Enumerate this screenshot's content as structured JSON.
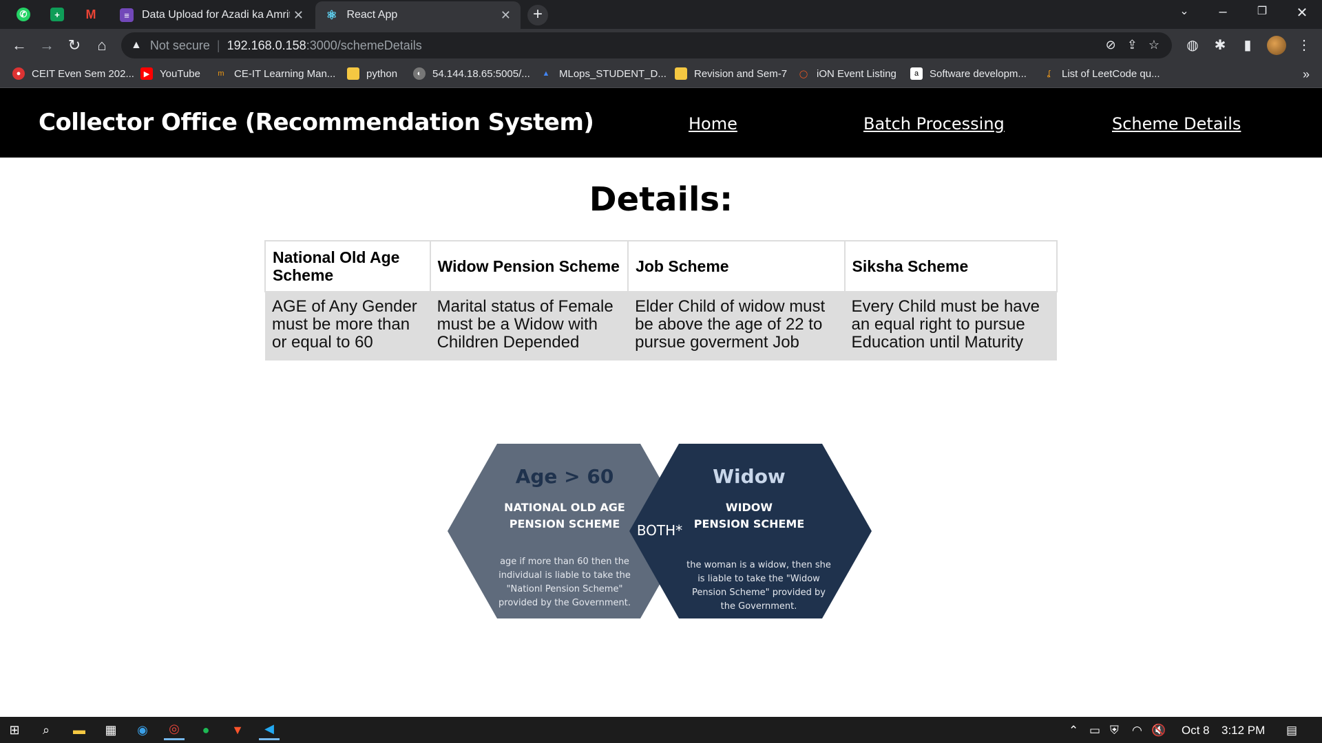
{
  "browser": {
    "tabs": [
      {
        "title": "Data Upload for Azadi ka Amrit M",
        "active": false
      },
      {
        "title": "React App",
        "active": true
      }
    ],
    "pinned_icons": [
      "whatsapp-icon",
      "sheets-icon",
      "gmail-icon"
    ],
    "address": {
      "security": "Not secure",
      "host": "192.168.0.158",
      "path": ":3000/schemeDetails"
    },
    "bookmarks": [
      "CEIT Even Sem 202...",
      "YouTube",
      "CE-IT Learning Man...",
      "python",
      "54.144.18.65:5005/...",
      "MLops_STUDENT_D...",
      "Revision and Sem-7",
      "iON Event Listing",
      "Software developm...",
      "List of LeetCode qu..."
    ]
  },
  "app": {
    "brand": "Collector Office (Recommendation System)",
    "nav": {
      "home": "Home",
      "batch": "Batch Processing",
      "scheme": "Scheme Details"
    },
    "heading": "Details:",
    "table": {
      "headers": [
        "National Old Age Scheme",
        "Widow Pension Scheme",
        "Job Scheme",
        "Siksha Scheme"
      ],
      "rows": [
        [
          "AGE of Any Gender must be more than or equal to 60",
          "Marital status of Female must be a Widow with Children Depended",
          "Elder Child of widow must be above the age of 22 to pursue goverment Job",
          "Every Child must be have an equal right to pursue Education until Maturity"
        ]
      ]
    },
    "diagram": {
      "left": {
        "title": "Age > 60",
        "line1": "NATIONAL OLD AGE",
        "line2": "PENSION SCHEME",
        "desc1": "age if more than 60 then the",
        "desc2": "individual is liable to take the",
        "desc3": "\"Nationl Pension Scheme\"",
        "desc4": "provided by the Government.",
        "color": "#5f6b7c"
      },
      "center": "BOTH*",
      "right": {
        "title": "Widow",
        "line1": "WIDOW",
        "line2": "PENSION SCHEME",
        "desc1": "the woman is a widow, then she",
        "desc2": "is liable to take the \"Widow",
        "desc3": "Pension Scheme\" provided by",
        "desc4": "the Government.",
        "color": "#1f324d"
      }
    }
  },
  "taskbar": {
    "date": "Oct 8",
    "time": "3:12 PM"
  }
}
